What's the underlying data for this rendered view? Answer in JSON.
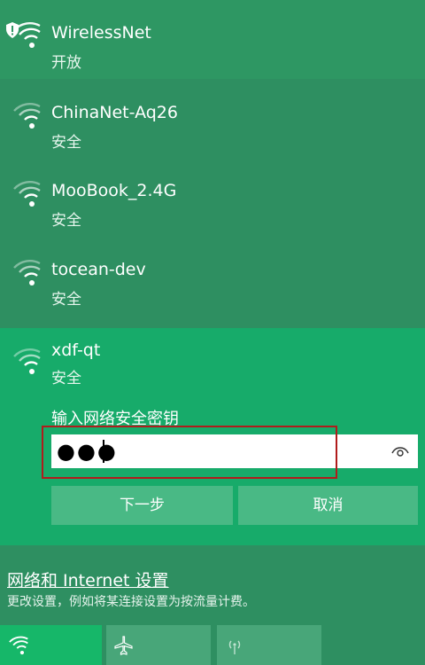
{
  "networks": [
    {
      "name": "WirelessNet",
      "status": "开放",
      "secured": false
    },
    {
      "name": "ChinaNet-Aq26",
      "status": "安全",
      "secured": true
    },
    {
      "name": "MooBook_2.4G",
      "status": "安全",
      "secured": true
    },
    {
      "name": "tocean-dev",
      "status": "安全",
      "secured": true
    }
  ],
  "selected": {
    "name": "xdf-qt",
    "status": "安全",
    "prompt": "输入网络安全密钥",
    "password_value": "●●●",
    "next_label": "下一步",
    "cancel_label": "取消"
  },
  "settings": {
    "link_label": "网络和 Internet 设置",
    "description": "更改设置，例如将某连接设置为按流量计费。"
  },
  "quick_actions": [
    {
      "id": "wifi",
      "icon": "wifi-icon",
      "active": true
    },
    {
      "id": "airplane",
      "icon": "airplane-icon",
      "active": false
    },
    {
      "id": "mobile-hotspot",
      "icon": "hotspot-icon",
      "active": false
    }
  ],
  "colors": {
    "panel_bg": "#2e8f61",
    "selected_bg": "#17ab6a",
    "button_bg": "#49b985",
    "annotation": "#b01c1c"
  }
}
